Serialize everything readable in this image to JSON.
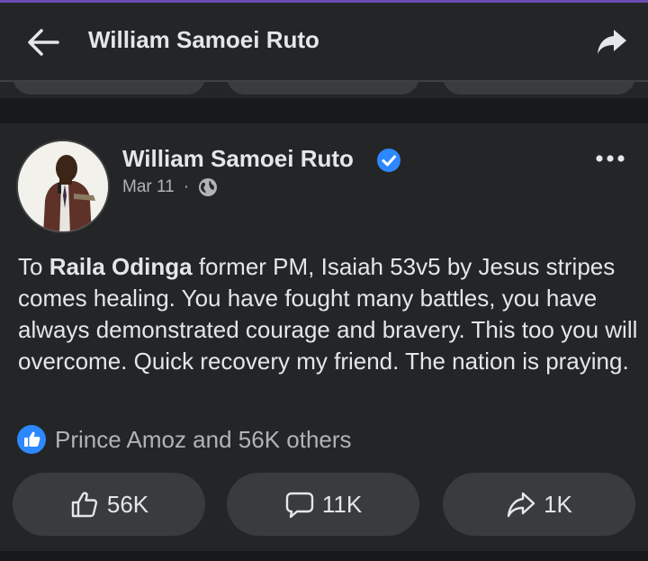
{
  "header": {
    "title": "William Samoei Ruto",
    "back_icon": "arrow-left-icon",
    "share_icon": "share-icon"
  },
  "post": {
    "author": "William Samoei Ruto",
    "verified_icon": "verified-badge-icon",
    "date": "Mar 11",
    "separator": "·",
    "privacy_icon": "globe-icon",
    "more_icon": "more-options-icon",
    "text_parts": [
      {
        "text": "To ",
        "bold": false
      },
      {
        "text": "Raila Odinga",
        "bold": true
      },
      {
        "text": " former PM, Isaiah 53v5 by Jesus stripes comes healing. You have fought many battles, you have always demonstrated courage and bravery. This too you will overcome. Quick recovery my friend. The nation is praying.",
        "bold": false
      }
    ],
    "reactions_text": "Prince Amoz and 56K others",
    "actions": {
      "like_count": "56K",
      "comment_count": "11K",
      "share_count": "1K"
    }
  },
  "colors": {
    "background": "#18191a",
    "surface": "#242526",
    "button": "#3a3b3c",
    "text_primary": "#e4e6eb",
    "text_secondary": "#b0b3b8",
    "accent_blue": "#2d88ff"
  }
}
